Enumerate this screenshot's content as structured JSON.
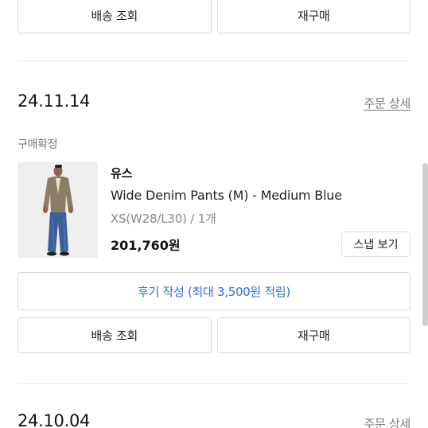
{
  "top_actions": {
    "tracking_label": "배송 조회",
    "reorder_label": "재구매"
  },
  "orders": [
    {
      "date": "24.11.14",
      "detail_link": "주문 상세",
      "status": "구매확정",
      "item": {
        "brand": "유스",
        "name": "Wide Denim Pants (M) - Medium Blue",
        "option": "XS(W28/L30) / 1개",
        "price": "201,760원",
        "snap_label": "스냅 보기"
      },
      "review_label": "후기 작성 (최대 3,500원 적립)",
      "tracking_label": "배송 조회",
      "reorder_label": "재구매"
    },
    {
      "date": "24.10.04",
      "detail_link": "주문 상세"
    }
  ]
}
